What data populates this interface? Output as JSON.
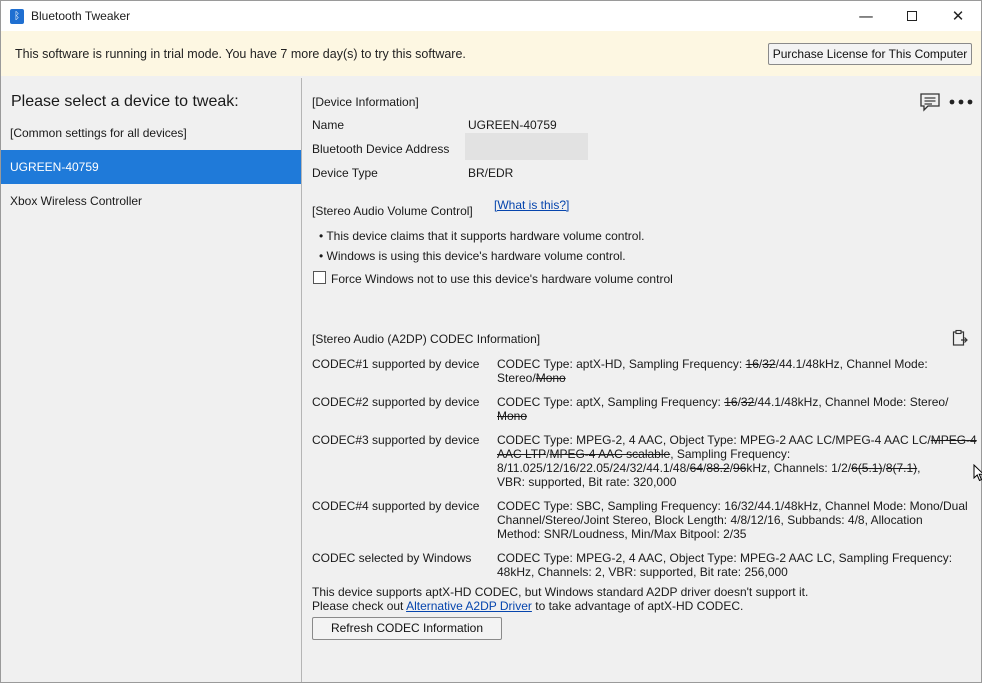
{
  "window": {
    "title": "Bluetooth Tweaker",
    "icon": "bluetooth-icon"
  },
  "trial": {
    "message": "This software is running in trial mode. You have 7 more day(s) to try this software.",
    "button": "Purchase License for This Computer"
  },
  "sidebar": {
    "title": "Please select a device to tweak:",
    "items": [
      {
        "label": "[Common settings for all devices]"
      },
      {
        "label": "UGREEN-40759",
        "selected": true
      },
      {
        "label": "Xbox Wireless Controller"
      }
    ]
  },
  "device_info": {
    "heading": "[Device Information]",
    "name_label": "Name",
    "name_value": "UGREEN-40759",
    "address_label": "Bluetooth Device Address",
    "type_label": "Device Type",
    "type_value": "BR/EDR"
  },
  "volume": {
    "heading": "[Stereo Audio Volume Control]",
    "what_link": "[What is this?]",
    "bullet1": "This device claims that it supports hardware volume control.",
    "bullet2": "Windows is using this device's hardware volume control.",
    "checkbox_label": "Force Windows not to use this device's hardware volume control",
    "checkbox_checked": false
  },
  "codec": {
    "heading": "[Stereo Audio (A2DP) CODEC Information]",
    "rows": [
      {
        "label": "CODEC#1 supported by device",
        "lines": [
          [
            {
              "t": "CODEC Type: aptX-HD, Sampling Frequency: "
            },
            {
              "t": "16",
              "s": true
            },
            {
              "t": "/"
            },
            {
              "t": "32",
              "s": true
            },
            {
              "t": "/44.1/48kHz, Channel Mode:"
            }
          ],
          [
            {
              "t": "Stereo/"
            },
            {
              "t": "Mono",
              "s": true
            }
          ]
        ]
      },
      {
        "label": "CODEC#2 supported by device",
        "lines": [
          [
            {
              "t": "CODEC Type: aptX, Sampling Frequency: "
            },
            {
              "t": "16",
              "s": true
            },
            {
              "t": "/"
            },
            {
              "t": "32",
              "s": true
            },
            {
              "t": "/44.1/48kHz, Channel Mode: Stereo/"
            }
          ],
          [
            {
              "t": "Mono",
              "s": true
            }
          ]
        ]
      },
      {
        "label": "CODEC#3 supported by device",
        "lines": [
          [
            {
              "t": "CODEC Type: MPEG-2, 4 AAC, Object Type: MPEG-2 AAC LC/MPEG-4 AAC LC/"
            },
            {
              "t": "MPEG-4",
              "s": true
            }
          ],
          [
            {
              "t": "AAC LTP",
              "s": true
            },
            {
              "t": "/"
            },
            {
              "t": "MPEG-4 AAC scalable",
              "s": true
            },
            {
              "t": ", Sampling Frequency:"
            }
          ],
          [
            {
              "t": "8/11.025/12/16/22.05/24/32/44.1/48/"
            },
            {
              "t": "64",
              "s": true
            },
            {
              "t": "/"
            },
            {
              "t": "88.2",
              "s": true
            },
            {
              "t": "/"
            },
            {
              "t": "96",
              "s": true
            },
            {
              "t": "kHz, Channels: 1/2/"
            },
            {
              "t": "6(5.1)",
              "s": true
            },
            {
              "t": "/"
            },
            {
              "t": "8(7.1)",
              "s": true
            },
            {
              "t": ","
            }
          ],
          [
            {
              "t": "VBR: supported, Bit rate: 320,000"
            }
          ]
        ]
      },
      {
        "label": "CODEC#4 supported by device",
        "lines": [
          [
            {
              "t": "CODEC Type: SBC, Sampling Frequency: 16/32/44.1/48kHz, Channel Mode: Mono/Dual"
            }
          ],
          [
            {
              "t": "Channel/Stereo/Joint Stereo, Block Length: 4/8/12/16, Subbands: 4/8, Allocation"
            }
          ],
          [
            {
              "t": "Method: SNR/Loudness, Min/Max Bitpool: 2/35"
            }
          ]
        ]
      },
      {
        "label": "CODEC selected by Windows",
        "lines": [
          [
            {
              "t": "CODEC Type: MPEG-2, 4 AAC, Object Type: MPEG-2 AAC LC, Sampling Frequency:"
            }
          ],
          [
            {
              "t": "48kHz, Channels: 2, VBR: supported, Bit rate: 256,000"
            }
          ]
        ]
      }
    ],
    "note1": "This device supports aptX-HD CODEC, but Windows standard A2DP driver doesn't support it.",
    "note2_pre": "Please check out ",
    "note2_link": "Alternative A2DP Driver",
    "note2_post": " to take advantage of aptX-HD CODEC.",
    "refresh_button": "Refresh CODEC Information"
  },
  "icons": {
    "feedback": "comment-icon",
    "more": "more-icon",
    "copy": "clipboard-icon"
  }
}
